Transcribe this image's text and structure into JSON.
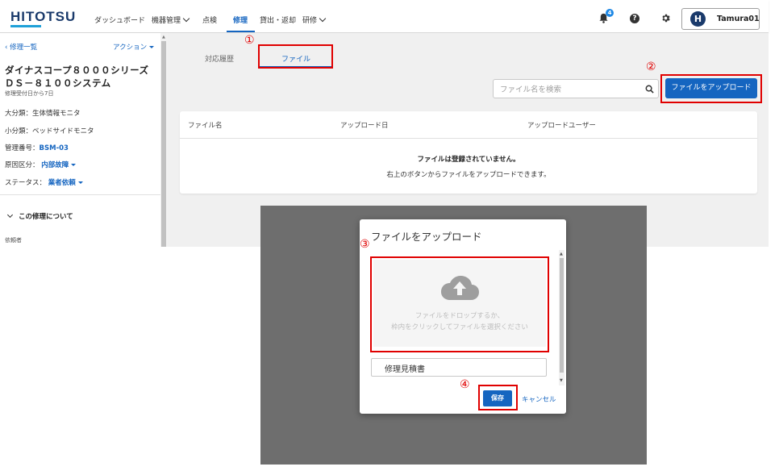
{
  "header": {
    "logo": "HITOTSU",
    "nav": [
      {
        "label": "ダッシュボード"
      },
      {
        "label": "機器管理"
      },
      {
        "label": "点検"
      },
      {
        "label": "修理"
      },
      {
        "label": "貸出・返却"
      },
      {
        "label": "研修"
      }
    ],
    "notification_count": "4",
    "help_glyph": "?",
    "avatar_initial": "H",
    "user_name": "Tamura01"
  },
  "sidebar": {
    "back_label": "修理一覧",
    "action_label": "アクション",
    "title": "ダイナスコープ８０００シリーズ ＤＳ－８１００システム",
    "subtitle": "修理受付日から7日",
    "major_category": "大分類：生体情報モニタ",
    "minor_category": "小分類：ベッドサイドモニタ",
    "management_label": "管理番号：",
    "management_value": "BSM-03",
    "cause_label": "原因区分：",
    "cause_value": "内部故障",
    "status_label": "ステータス：",
    "status_value": "業者依頼",
    "about_label": "この修理について",
    "requester_label": "依頼者"
  },
  "main": {
    "tabs": [
      {
        "label": "対応履歴"
      },
      {
        "label": "ファイル"
      }
    ],
    "search_placeholder": "ファイル名を検索",
    "upload_button": "ファイルをアップロード",
    "columns": [
      "ファイル名",
      "アップロード日",
      "アップロードユーザー"
    ],
    "empty_title": "ファイルは登録されていません。",
    "empty_desc": "右上のボタンからファイルをアップロードできます。"
  },
  "modal": {
    "title": "ファイルをアップロード",
    "drop_line1": "ファイルをドロップするか、",
    "drop_line2": "枠内をクリックしてファイルを選択ください",
    "filename_value": "修理見積書",
    "save_label": "保存",
    "cancel_label": "キャンセル"
  },
  "annotations": {
    "marker1": "①",
    "marker2": "②",
    "marker3": "③",
    "marker4": "④",
    "color": "#e00000"
  },
  "colors": {
    "accent": "#1565c0",
    "brand": "#1a3a6b",
    "overlay": "#6e6e6e"
  }
}
